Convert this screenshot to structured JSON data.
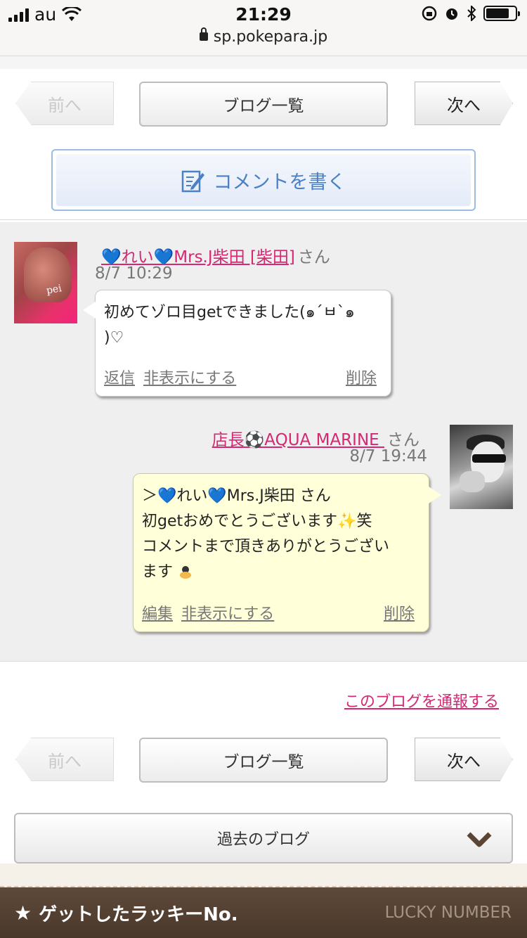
{
  "status_bar": {
    "carrier": "au",
    "time": "21:29",
    "url": "sp.pokepara.jp"
  },
  "nav": {
    "prev": "前へ",
    "list": "ブログ一覧",
    "next": "次へ"
  },
  "write_comment": "コメントを書く",
  "comments": [
    {
      "name": "💙れい💙Mrs.J柴田 [柴田]",
      "honorific": "さん",
      "date": "8/7 10:29",
      "text_line1": "初めてゾロ目getできました(๑´ㅂ`๑",
      "text_line2": ")♡",
      "actions": [
        "返信",
        "非表示にする",
        "削除"
      ]
    },
    {
      "name": "店長⚽AQUA MARINE ",
      "honorific": "さん",
      "date": "8/7 19:44",
      "text_line1": "＞💙れい💙Mrs.J柴田 さん",
      "text_line2": "初getおめでとうございます✨笑",
      "text_line3": "コメントまで頂きありがとうござい",
      "text_line4": "ます",
      "actions": [
        "編集",
        "非表示にする",
        "削除"
      ]
    }
  ],
  "report_link": "このブログを通報する",
  "past_blog": "過去のブログ",
  "lucky": {
    "title": "ゲットしたラッキーNo.",
    "subtitle": "LUCKY NUMBER"
  },
  "colors": {
    "accent_pink": "#d42873",
    "write_blue": "#4a80c4",
    "bubble_yellow": "#ffffd9",
    "footer_brown": "#4a382a"
  }
}
